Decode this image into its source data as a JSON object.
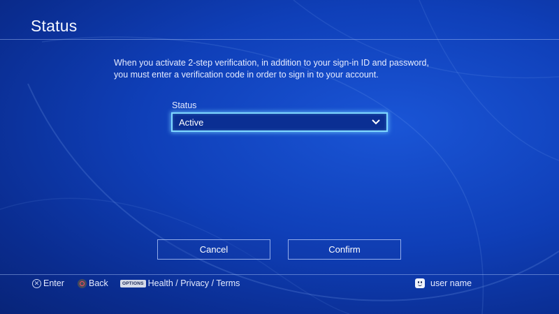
{
  "page": {
    "title": "Status",
    "description_line1": "When you activate 2-step verification, in addition to your sign-in ID and password,",
    "description_line2": "you must enter a verification code in order to sign in to your account."
  },
  "status_field": {
    "label": "Status",
    "selected_value": "Active"
  },
  "buttons": {
    "cancel": "Cancel",
    "confirm": "Confirm"
  },
  "footer": {
    "enter_label": "Enter",
    "enter_icon": "cross-icon",
    "back_label": "Back",
    "back_icon": "circle-icon",
    "options_badge": "OPTIONS",
    "options_label": "Health / Privacy / Terms",
    "user_icon": "avatar-icon",
    "user_name": "user name"
  },
  "colors": {
    "background": "#0f3fb8",
    "focus_outline": "#7fd8ff",
    "text": "#ffffff",
    "back_button_accent": "#ff4e5a"
  }
}
